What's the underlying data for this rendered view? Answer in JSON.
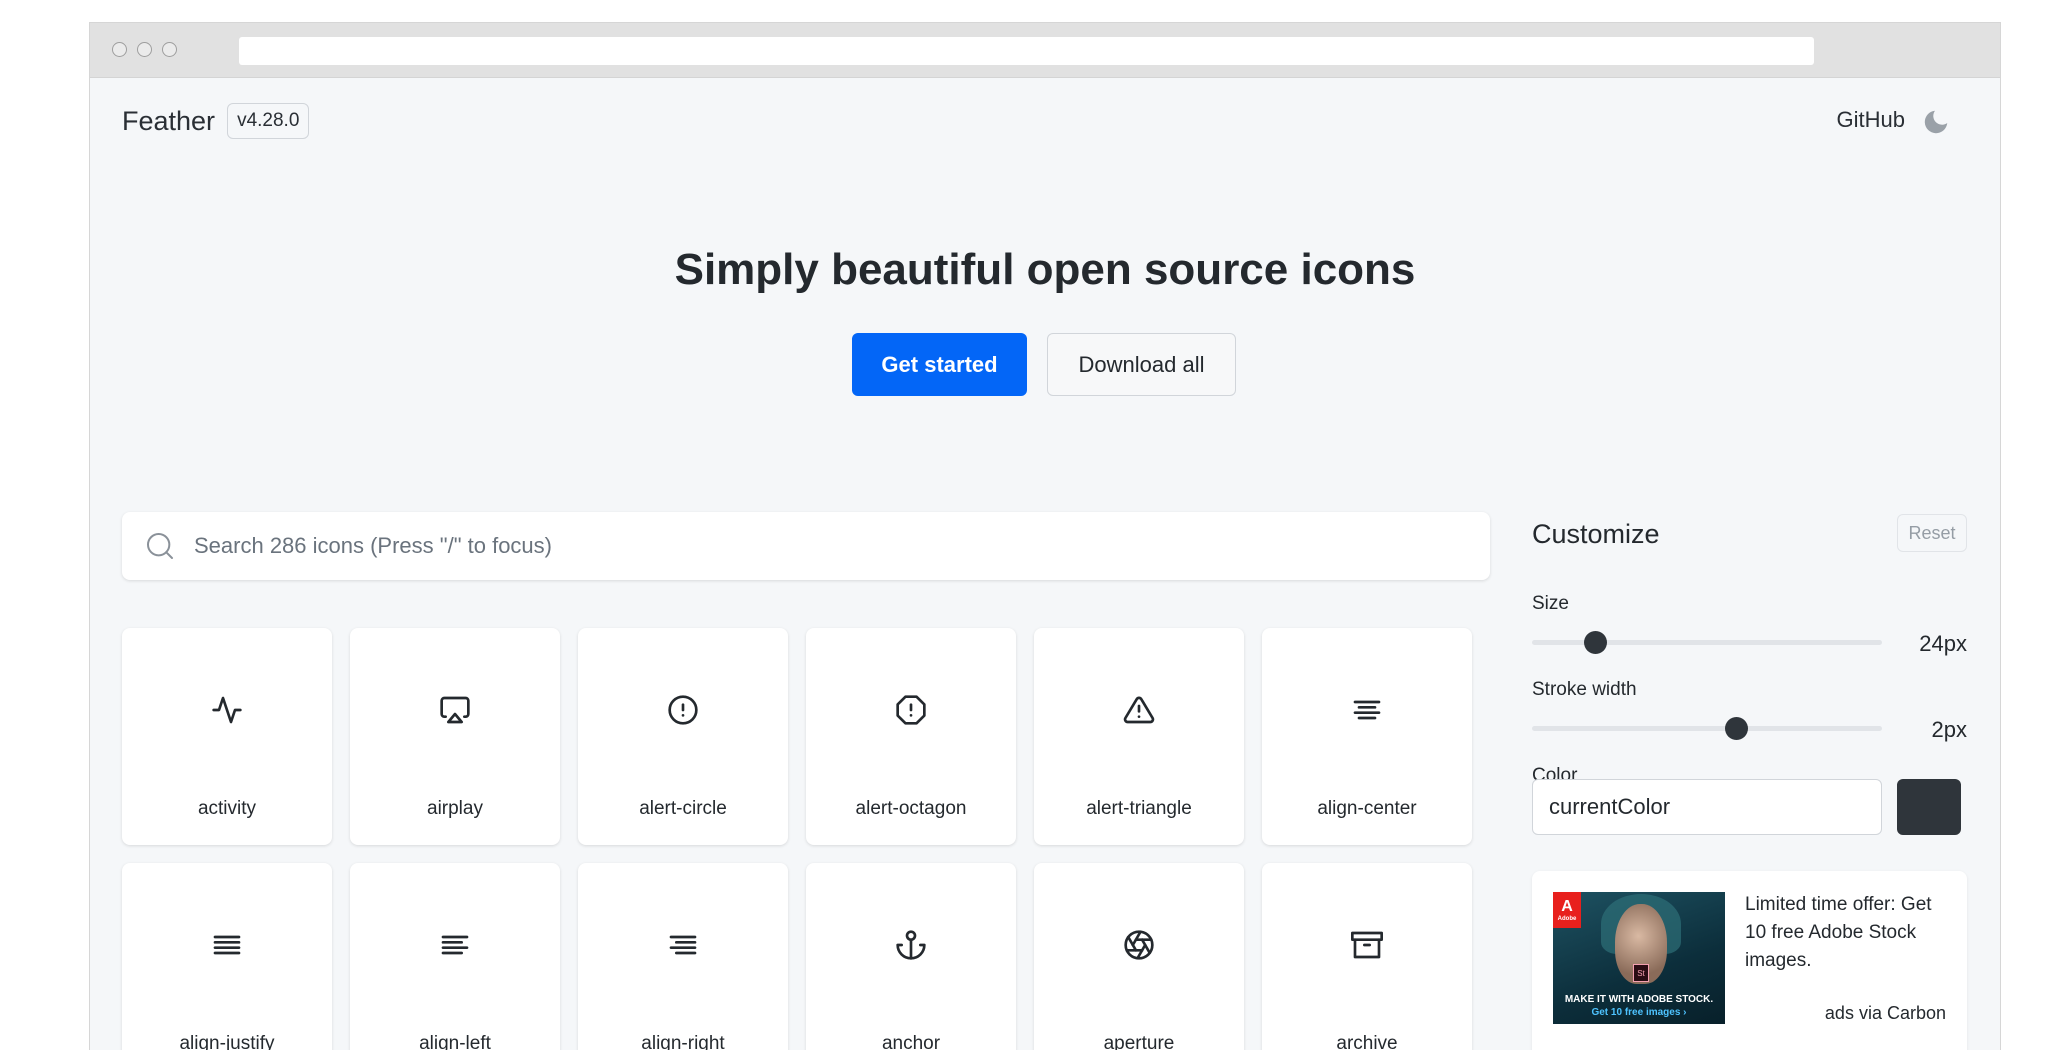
{
  "header": {
    "brand": "Feather",
    "version": "v4.28.0",
    "github_label": "GitHub",
    "theme_icon": "moon-icon"
  },
  "hero": {
    "title": "Simply beautiful open source icons",
    "primary_button": "Get started",
    "secondary_button": "Download all"
  },
  "search": {
    "placeholder": "Search 286 icons (Press \"/\" to focus)"
  },
  "icons": [
    {
      "name": "activity"
    },
    {
      "name": "airplay"
    },
    {
      "name": "alert-circle"
    },
    {
      "name": "alert-octagon"
    },
    {
      "name": "alert-triangle"
    },
    {
      "name": "align-center"
    },
    {
      "name": "align-justify"
    },
    {
      "name": "align-left"
    },
    {
      "name": "align-right"
    },
    {
      "name": "anchor"
    },
    {
      "name": "aperture"
    },
    {
      "name": "archive"
    }
  ],
  "customize": {
    "title": "Customize",
    "reset_label": "Reset",
    "size_label": "Size",
    "size_value": "24px",
    "size_fraction": 0.16,
    "stroke_label": "Stroke width",
    "stroke_value": "2px",
    "stroke_fraction": 0.59,
    "color_label": "Color",
    "color_value": "currentColor",
    "swatch_color": "#2f353b"
  },
  "ad": {
    "text": "Limited time offer: Get 10 free Adobe Stock images.",
    "via": "ads via Carbon",
    "image_caption_1": "MAKE IT WITH ADOBE STOCK.",
    "image_caption_2": "Get 10 free images ›",
    "logo_text": "Adobe"
  },
  "colors": {
    "primary": "#0366f7",
    "background": "#f5f7f9"
  }
}
